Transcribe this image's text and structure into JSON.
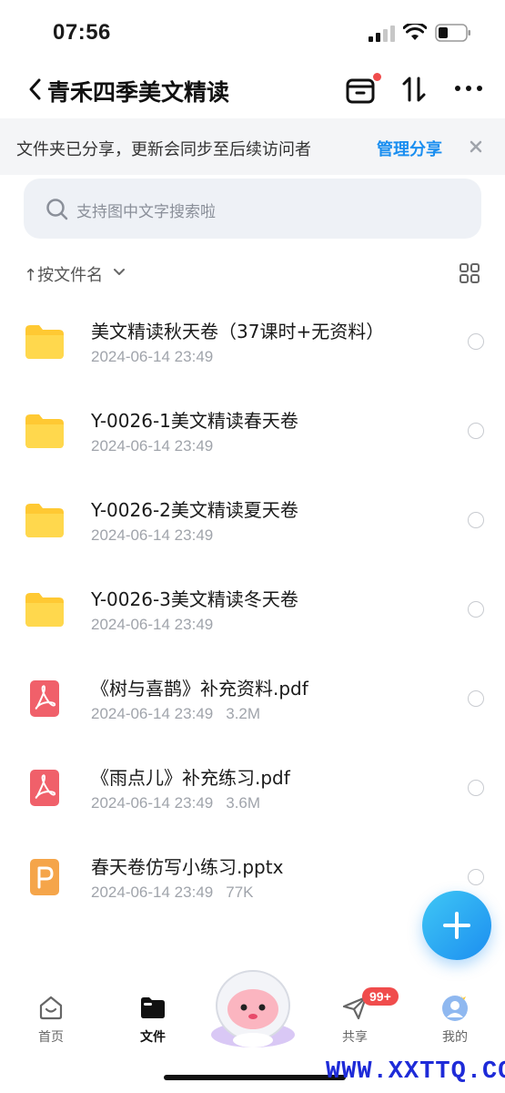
{
  "status": {
    "time": "07:56"
  },
  "nav": {
    "title": "青禾四季美文精读"
  },
  "banner": {
    "text": "文件夹已分享，更新会同步至后续访问者",
    "action": "管理分享"
  },
  "search": {
    "placeholder": "支持图中文字搜索啦"
  },
  "sort": {
    "label": "↑按文件名"
  },
  "files": [
    {
      "name": "美文精读秋天卷（37课时+无资料）",
      "date": "2024-06-14 23:49",
      "size": "",
      "type": "folder"
    },
    {
      "name": "Y-0026-1美文精读春天卷",
      "date": "2024-06-14 23:49",
      "size": "",
      "type": "folder"
    },
    {
      "name": "Y-0026-2美文精读夏天卷",
      "date": "2024-06-14 23:49",
      "size": "",
      "type": "folder"
    },
    {
      "name": "Y-0026-3美文精读冬天卷",
      "date": "2024-06-14 23:49",
      "size": "",
      "type": "folder"
    },
    {
      "name": "《树与喜鹊》补充资料.pdf",
      "date": "2024-06-14 23:49",
      "size": "3.2M",
      "type": "pdf"
    },
    {
      "name": "《雨点儿》补充练习.pdf",
      "date": "2024-06-14 23:49",
      "size": "3.6M",
      "type": "pdf"
    },
    {
      "name": "春天卷仿写小练习.pptx",
      "date": "2024-06-14 23:49",
      "size": "77K",
      "type": "pptx"
    }
  ],
  "tabs": [
    {
      "label": "首页",
      "icon": "home-icon"
    },
    {
      "label": "文件",
      "icon": "folder-icon"
    },
    {
      "label": "共享",
      "icon": "paper-plane-icon"
    },
    {
      "label": "我的",
      "icon": "avatar-icon"
    }
  ],
  "share_badge": "99+",
  "watermark": "WWW.XXTTQ.COM",
  "colors": {
    "accent": "#1a8ef0",
    "folder": "#ffc933",
    "pdf": "#f0606a",
    "pptx": "#f5a54a",
    "badge": "#f04c4c"
  }
}
